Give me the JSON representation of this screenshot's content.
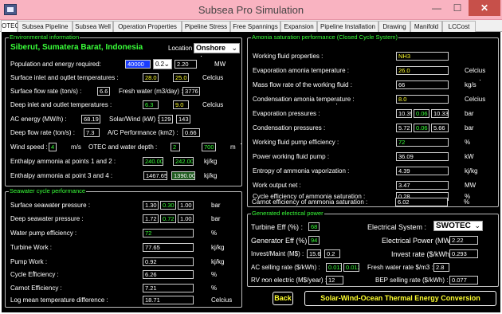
{
  "window": {
    "title": "Subsea Pro Simulation",
    "min": "—",
    "max": "☐",
    "close": "✕"
  },
  "tabs": [
    "OTEC",
    "Subsea Pipeline",
    "Subsea Well",
    "Operation Properties",
    "Pipeline Stress",
    "Free Spannings",
    "Expansion",
    "Pipeline Installation",
    "Drawing",
    "Manifold",
    "LCCost"
  ],
  "env": {
    "title": "Environmental information",
    "location_name": "Siberut, Sumatera Barat, Indonesia",
    "location_label": "Location :",
    "location_value": "Onshore",
    "population_label": "Population and energy required:",
    "population_value": "40000",
    "population_factor": "0.2",
    "energy_value": "2.20",
    "energy_unit": "MW",
    "surface_temp_label": "Surface inlet and outlet temperatures :",
    "surface_temp_in": "28.0",
    "surface_temp_out": "25.0",
    "temp_unit": "Celcius",
    "surface_flow_label": "Surface flow rate (ton/s) :",
    "surface_flow_value": "6.6",
    "fresh_water_label": "Fresh water (m3/day) :",
    "fresh_water_value": "3776",
    "deep_temp_label": "Deep inlet and outlet temperatures :",
    "deep_temp_in": "6.3",
    "deep_temp_out": "9.0",
    "deep_temp_unit": "Celcius",
    "ac_energy_label": "AC energy (MW/h) :",
    "ac_energy_value": "68.19",
    "solar_wind_label": "Solar/Wind (kW) :",
    "solar_value": "129",
    "wind_value": "143",
    "deep_flow_label": "Deep flow rate (ton/s) :",
    "deep_flow_value": "7.3",
    "ac_perf_label": "A/C Performance (km2) :",
    "ac_perf_value": "0.66",
    "wind_speed_label": "Wind speed :",
    "wind_speed_value": "4",
    "wind_speed_unit": "m/s",
    "otec_depth_label": "OTEC and water depth :",
    "otec_depth_value": "2",
    "water_depth_value": "700",
    "depth_unit": "m",
    "enthalpy12_label": "Enthalpy ammonia at points 1 and 2 :",
    "enthalpy1": "240.00",
    "enthalpy2": "242.00",
    "enthalpy_unit": "kj/kg",
    "enthalpy34_label": "Enthalpy ammonia at point 3 and 4 :",
    "enthalpy3": "1467.65",
    "enthalpy4": "1390.00",
    "enthalpy34_unit": "kj/kg"
  },
  "sw": {
    "title": "Seawater cycle performance",
    "rows": [
      {
        "label": "Surface seawater pressure :",
        "unit": "bar"
      },
      {
        "label": "Deep seawater pressure :",
        "unit": "bar"
      },
      {
        "label": "Water pump efficiency :",
        "value": "72",
        "unit": "%"
      },
      {
        "label": "Turbine Work :",
        "value": "77.65",
        "unit": "kj/kg"
      },
      {
        "label": "Pump Work :",
        "value": "0.92",
        "unit": "kj/kg"
      },
      {
        "label": "Cycle Efficiency :",
        "value": "6.26",
        "unit": "%"
      },
      {
        "label": "Carnot Efficiency :",
        "value": "7.21",
        "unit": "%"
      },
      {
        "label": "Log mean temperature difference :",
        "value": "18.71",
        "unit": "Celcius"
      }
    ],
    "surface_p": [
      "1.30",
      "0.30",
      "1.00"
    ],
    "deep_p": [
      "1.72",
      "0.72",
      "1.00"
    ]
  },
  "amm": {
    "title": "Amonia saturation performance (Closed Cycle System)",
    "rows": [
      {
        "label": "Working fluid properties :",
        "value": "NH3",
        "unit": ""
      },
      {
        "label": "Evaporation amonia temperature :",
        "value": "26.0",
        "unit": "Celcius"
      },
      {
        "label": "Mass flow rate of the working fluid :",
        "value": "66",
        "unit": "kg/s"
      },
      {
        "label": "Condensation amonia temperature :",
        "value": "8.0",
        "unit": "Celcius"
      },
      {
        "label": "Evaporation pressures :",
        "unit": "bar"
      },
      {
        "label": "Condensation pressures :",
        "unit": "bar"
      },
      {
        "label": "Working fluid pump efficiency :",
        "value": "72",
        "unit": "%"
      },
      {
        "label": "Power working fluid pump :",
        "value": "36.09",
        "unit": "kW"
      },
      {
        "label": "Entropy of ammonia vaporization :",
        "value": "4.39",
        "unit": "kj/kg"
      },
      {
        "label": "Work output net :",
        "value": "3.47",
        "unit": "MW"
      },
      {
        "label": "Cycle efficiency of ammonia saturation :",
        "value": "0.28",
        "unit": "%"
      },
      {
        "label": "Carnot efficiency of ammonia saturation :",
        "value": "6.02",
        "unit": "%"
      }
    ],
    "evap_p": [
      "10.39",
      "0.06",
      "10.33"
    ],
    "cond_p": [
      "5.72",
      "0.06",
      "5.66"
    ]
  },
  "gen": {
    "title": "Generated electrical power",
    "turbine_eff_label": "Turbine Eff (%) :",
    "turbine_eff_value": "68",
    "elec_system_label": "Electrical System :",
    "elec_system_value": "SWOTEC",
    "gen_eff_label": "Generator Eff (%) :",
    "gen_eff_value": "94",
    "elec_power_label": "Electrical Power (MW) :",
    "elec_power_value": "2.22",
    "invest_label": "Invest/Maint (M$) :",
    "invest_value": "15.6",
    "maint_value": "0.2",
    "invest_rate_label": "Invest rate ($/kWh) :",
    "invest_rate_value": "0.293",
    "ac_rate_label": "AC selling rate ($/kWh) :",
    "ac_rate_1": "0.013",
    "ac_rate_2": "0.013",
    "fw_rate_label": "Fresh water rate $/m3 :",
    "fw_rate_value": "2.8",
    "rv_label": "RV non electric (M$/year) :",
    "rv_value": "12",
    "bep_label": "BEP selling rate ($/kWh) :",
    "bep_value": "0.077"
  },
  "back_label": "Back",
  "banner": "Solar-Wind-Ocean Thermal Energy Conversion",
  "colors": {
    "titlebar": "#f9b3c1",
    "close": "#c7504a",
    "field_green": "#39ff39",
    "field_yellow": "#ffff2e",
    "background": "#000000"
  }
}
